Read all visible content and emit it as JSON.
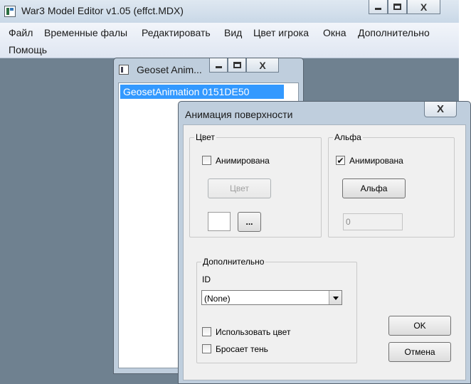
{
  "main_window": {
    "title": "War3 Model Editor v1.05 (effct.MDX)",
    "close_glyph": "X"
  },
  "menubar": {
    "items": [
      "Файл",
      "Временные фалы",
      "Редактировать",
      "Вид",
      "Цвет игрока",
      "Окна",
      "Дополнительно",
      "Помощь"
    ]
  },
  "geoset_window": {
    "title": "Geoset Anim...",
    "list_items": [
      "GeosetAnimation 0151DE50"
    ]
  },
  "dialog": {
    "title": "Анимация поверхности",
    "close_glyph": "X",
    "color_group": {
      "legend": "Цвет",
      "animated_label": "Анимирована",
      "animated_checked": false,
      "color_button": "Цвет",
      "browse_button": "..."
    },
    "alpha_group": {
      "legend": "Альфа",
      "animated_label": "Анимирована",
      "animated_checked": true,
      "alpha_button": "Альфа",
      "alpha_value": "0"
    },
    "extra_group": {
      "legend": "Дополнительно",
      "id_label": "ID",
      "id_selected": "(None)",
      "use_color_label": "Использовать цвет",
      "use_color_checked": false,
      "drops_shadow_label": "Бросает тень",
      "drops_shadow_checked": false
    },
    "ok_button": "OK",
    "cancel_button": "Отмена"
  },
  "checkmark_glyph": "✔"
}
